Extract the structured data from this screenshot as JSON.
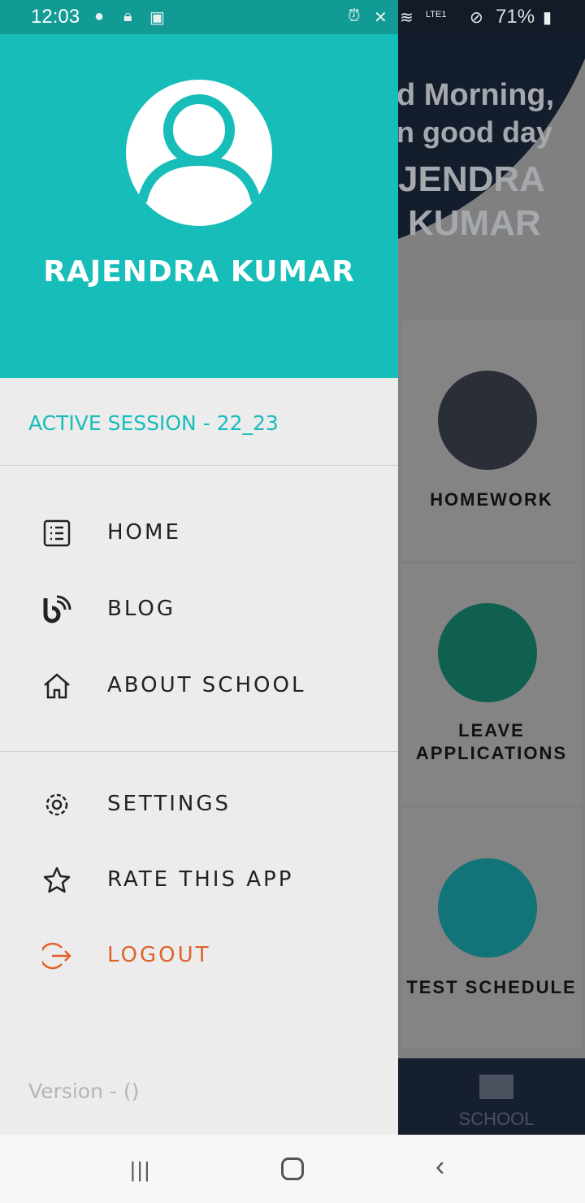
{
  "status_bar": {
    "time": "12:03",
    "battery": "71%",
    "network": "LTE1"
  },
  "background": {
    "greeting_line1": "d Morning,",
    "greeting_line2": "n good day",
    "name_line1": "JENDRA",
    "name_line2": "KUMAR",
    "tiles": [
      {
        "label1": "HOMEWORK",
        "label2": "",
        "color": "#2a2e37"
      },
      {
        "label1": "LEAVE",
        "label2": "APPLICATIONS",
        "color": "#10604f"
      },
      {
        "label1": "TEST SCHEDULE",
        "label2": "",
        "color": "#127378"
      }
    ],
    "bottom_nav": {
      "label": "SCHOOL"
    }
  },
  "drawer": {
    "user_name": "RAJENDRA KUMAR",
    "session": "ACTIVE SESSION - 22_23",
    "menu": [
      {
        "label": "HOME",
        "icon": "list-icon"
      },
      {
        "label": "BLOG",
        "icon": "blog-icon"
      },
      {
        "label": "ABOUT SCHOOL",
        "icon": "home-icon"
      }
    ],
    "menu2": [
      {
        "label": "SETTINGS",
        "icon": "gear-icon"
      },
      {
        "label": "RATE THIS APP",
        "icon": "star-icon"
      },
      {
        "label": "LOGOUT",
        "icon": "logout-icon",
        "color": "#e0622a"
      }
    ],
    "version": "Version -  ()"
  },
  "colors": {
    "accent": "#17bdb9",
    "logout": "#e0622a"
  }
}
